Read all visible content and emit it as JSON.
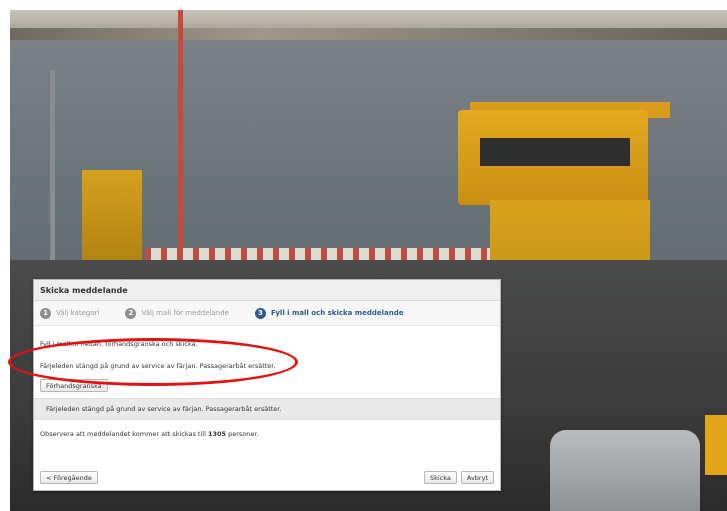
{
  "dialog": {
    "title": "Skicka meddelande",
    "steps": [
      {
        "num": "1",
        "label": "Välj kategori"
      },
      {
        "num": "2",
        "label": "Välj mall för meddelande"
      },
      {
        "num": "3",
        "label": "Fyll i mall och skicka meddelande"
      }
    ],
    "active_step": 3,
    "instruction": "Fyll i mallen nedan, förhandsgranska och skicka.",
    "message_input_value": "Färjeleden stängd på grund av service av färjan. Passagerarbåt ersätter.",
    "preview_button": "Förhandsgranska",
    "preview_text": "Färjeleden stängd på grund av service av färjan. Passagerarbåt ersätter.",
    "notice_prefix": "Observera att meddelandet kommer att skickas till ",
    "recipient_count": "1305",
    "notice_suffix": " personer.",
    "back_button": "< Föregående",
    "send_button": "Skicka",
    "cancel_button": "Avbryt"
  },
  "colors": {
    "highlight_oval": "#e01212",
    "active_step": "#2f5d8f"
  }
}
